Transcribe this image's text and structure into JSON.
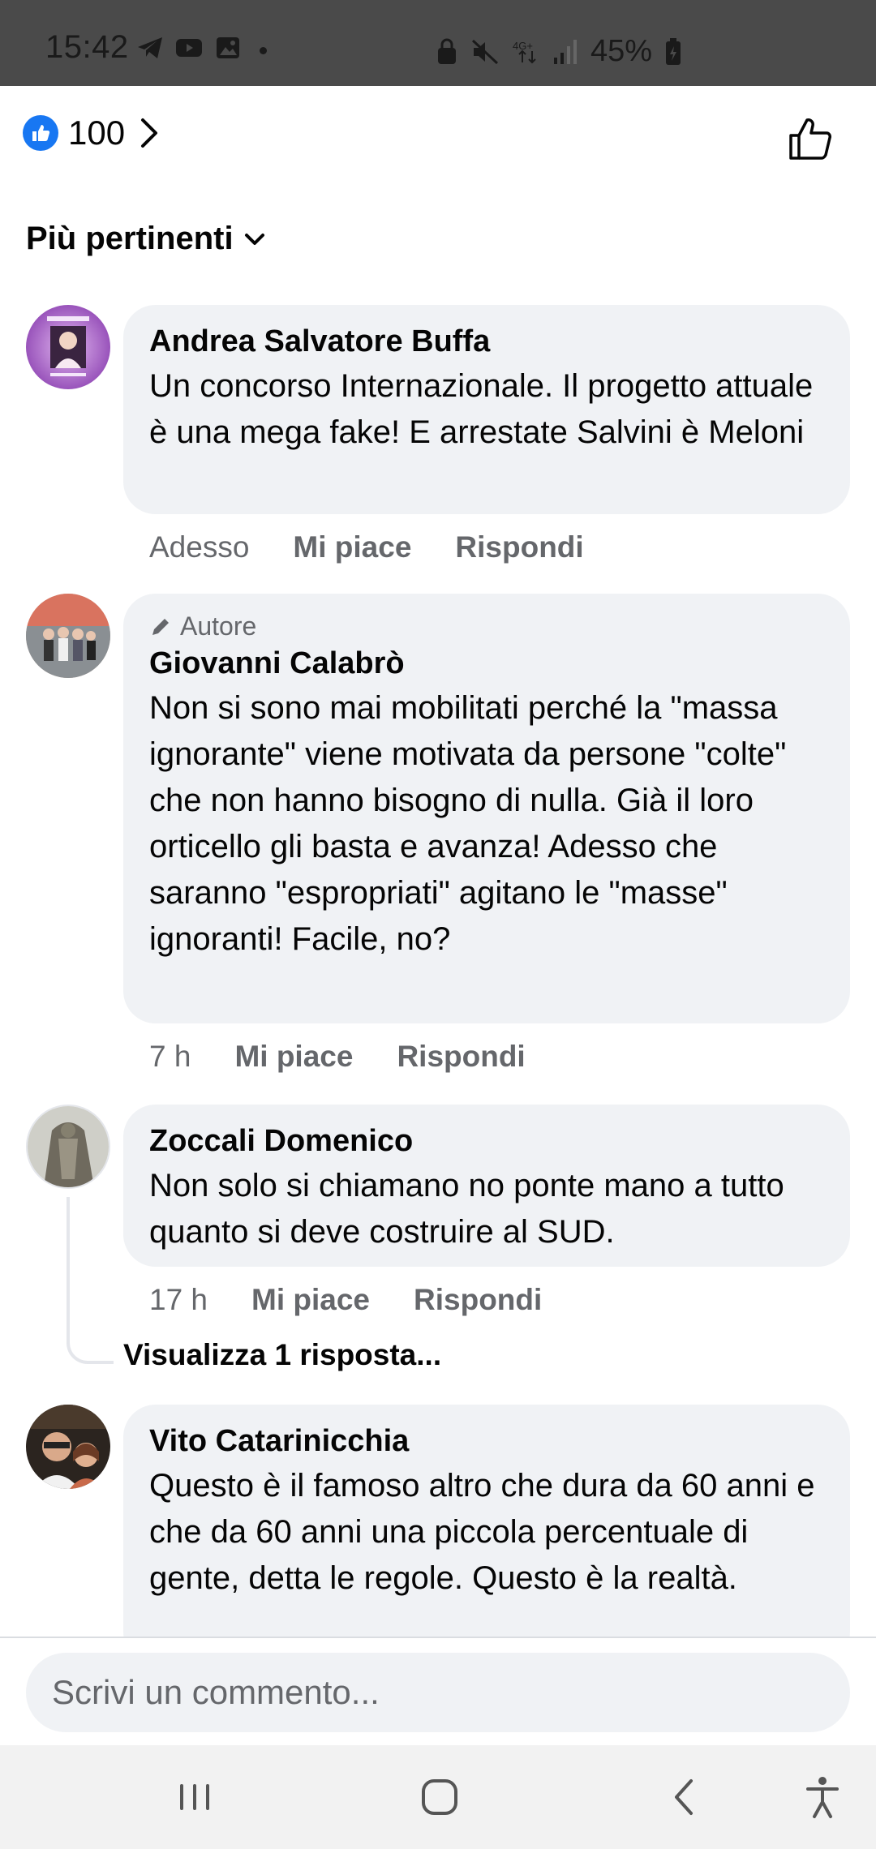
{
  "status_bar": {
    "time": "15:42",
    "network": "4G+",
    "battery": "45%"
  },
  "reactions": {
    "count": "100"
  },
  "sort": {
    "label": "Più pertinenti"
  },
  "comments": [
    {
      "author": "Andrea Salvatore Buffa",
      "text": "Un concorso Internazionale. Il progetto attuale è una mega fake! E arrestate Salvini è Meloni",
      "time": "Adesso",
      "like_label": "Mi piace",
      "reply_label": "Rispondi"
    },
    {
      "badge": "Autore",
      "author": "Giovanni Calabrò",
      "text": "Non si sono mai mobilitati perché  la \"massa ignorante\" viene motivata da persone \"colte\" che non hanno bisogno di nulla. Già il loro orticello gli basta e avanza! Adesso che saranno \"espropriati\" agitano le \"masse\" ignoranti! Facile, no?",
      "time": "7 h",
      "like_label": "Mi piace",
      "reply_label": "Rispondi"
    },
    {
      "author": "Zoccali Domenico",
      "text": "Non solo si chiamano no ponte mano a tutto quanto si deve costruire al SUD.",
      "time": "17 h",
      "like_label": "Mi piace",
      "reply_label": "Rispondi",
      "view_replies": "Visualizza 1 risposta..."
    },
    {
      "author": "Vito Catarinicchia",
      "text": "Questo è il famoso altro che dura da 60 anni e che da 60 anni una piccola percentuale di gente, detta le regole. Questo è la realtà."
    }
  ],
  "composer": {
    "placeholder": "Scrivi un commento..."
  },
  "colors": {
    "accent": "#1877f2",
    "bubble": "#f0f2f5",
    "secondary_text": "#65676b",
    "status_bar": "#4a4a4a"
  }
}
